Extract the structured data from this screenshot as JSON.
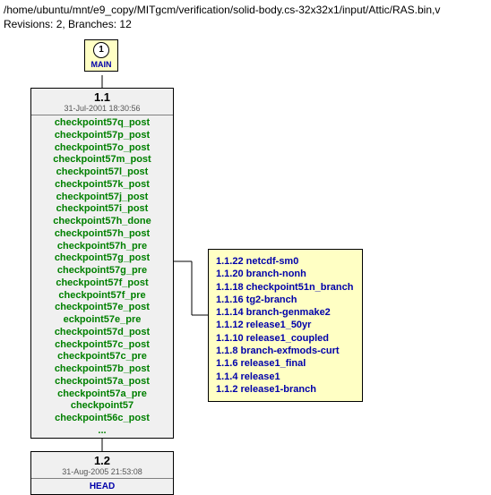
{
  "header": {
    "path": "/home/ubuntu/mnt/e9_copy/MITgcm/verification/solid-body.cs-32x32x1/input/Attic/RAS.bin,v",
    "stats": "Revisions: 2, Branches: 12"
  },
  "main": {
    "circle": "1",
    "label": "MAIN"
  },
  "rev1": {
    "title": "1.1",
    "time": "31-Jul-2001 18:30:56",
    "tags": [
      "checkpoint57q_post",
      "checkpoint57p_post",
      "checkpoint57o_post",
      "checkpoint57m_post",
      "checkpoint57l_post",
      "checkpoint57k_post",
      "checkpoint57j_post",
      "checkpoint57i_post",
      "checkpoint57h_done",
      "checkpoint57h_post",
      "checkpoint57h_pre",
      "checkpoint57g_post",
      "checkpoint57g_pre",
      "checkpoint57f_post",
      "checkpoint57f_pre",
      "checkpoint57e_post",
      "eckpoint57e_pre",
      "checkpoint57d_post",
      "checkpoint57c_post",
      "checkpoint57c_pre",
      "checkpoint57b_post",
      "checkpoint57a_post",
      "checkpoint57a_pre",
      "checkpoint57",
      "checkpoint56c_post",
      "..."
    ]
  },
  "rev2": {
    "title": "1.2",
    "time": "31-Aug-2005 21:53:08",
    "head": "HEAD"
  },
  "branches": [
    {
      "num": "1.1.22",
      "name": "netcdf-sm0"
    },
    {
      "num": "1.1.20",
      "name": "branch-nonh"
    },
    {
      "num": "1.1.18",
      "name": "checkpoint51n_branch"
    },
    {
      "num": "1.1.16",
      "name": "tg2-branch"
    },
    {
      "num": "1.1.14",
      "name": "branch-genmake2"
    },
    {
      "num": "1.1.12",
      "name": "release1_50yr"
    },
    {
      "num": "1.1.10",
      "name": "release1_coupled"
    },
    {
      "num": "1.1.8",
      "name": "branch-exfmods-curt"
    },
    {
      "num": "1.1.6",
      "name": "release1_final"
    },
    {
      "num": "1.1.4",
      "name": "release1"
    },
    {
      "num": "1.1.2",
      "name": "release1-branch"
    }
  ]
}
